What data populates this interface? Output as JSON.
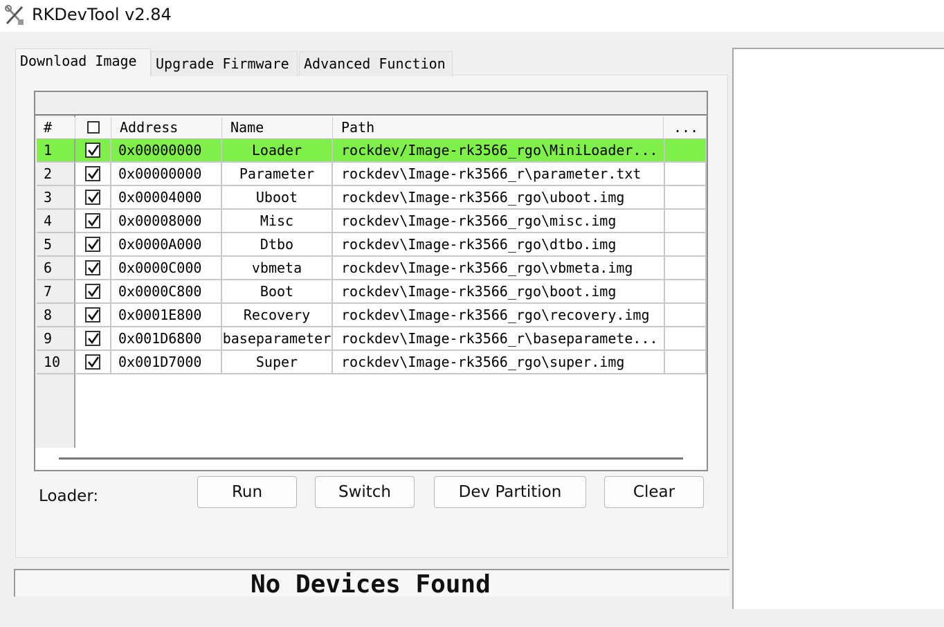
{
  "window": {
    "title": "RKDevTool v2.84",
    "icon": "rk-tools-icon"
  },
  "tabs": [
    {
      "label": "Download Image",
      "active": true
    },
    {
      "label": "Upgrade Firmware",
      "active": false
    },
    {
      "label": "Advanced Function",
      "active": false
    }
  ],
  "table": {
    "headers": {
      "num": "#",
      "address": "Address",
      "name": "Name",
      "path": "Path",
      "extra": "..."
    },
    "rows": [
      {
        "num": "1",
        "checked": true,
        "address": "0x00000000",
        "name": "Loader",
        "path": "rockdev/Image-rk3566_rgo\\MiniLoader...",
        "selected": true
      },
      {
        "num": "2",
        "checked": true,
        "address": "0x00000000",
        "name": "Parameter",
        "path": "rockdev\\Image-rk3566_r\\parameter.txt",
        "selected": false
      },
      {
        "num": "3",
        "checked": true,
        "address": "0x00004000",
        "name": "Uboot",
        "path": "rockdev\\Image-rk3566_rgo\\uboot.img",
        "selected": false
      },
      {
        "num": "4",
        "checked": true,
        "address": "0x00008000",
        "name": "Misc",
        "path": "rockdev\\Image-rk3566_rgo\\misc.img",
        "selected": false
      },
      {
        "num": "5",
        "checked": true,
        "address": "0x0000A000",
        "name": "Dtbo",
        "path": "rockdev\\Image-rk3566_rgo\\dtbo.img",
        "selected": false
      },
      {
        "num": "6",
        "checked": true,
        "address": "0x0000C000",
        "name": "vbmeta",
        "path": "rockdev\\Image-rk3566_rgo\\vbmeta.img",
        "selected": false
      },
      {
        "num": "7",
        "checked": true,
        "address": "0x0000C800",
        "name": "Boot",
        "path": "rockdev\\Image-rk3566_rgo\\boot.img",
        "selected": false
      },
      {
        "num": "8",
        "checked": true,
        "address": "0x0001E800",
        "name": "Recovery",
        "path": "rockdev\\Image-rk3566_rgo\\recovery.img",
        "selected": false
      },
      {
        "num": "9",
        "checked": true,
        "address": "0x001D6800",
        "name": "baseparameter",
        "path": "rockdev\\Image-rk3566_r\\baseparamete...",
        "selected": false
      },
      {
        "num": "10",
        "checked": true,
        "address": "0x001D7000",
        "name": "Super",
        "path": "rockdev\\Image-rk3566_rgo\\super.img",
        "selected": false
      }
    ]
  },
  "loader_label": "Loader:",
  "buttons": {
    "run": "Run",
    "switch": "Switch",
    "dev_partition": "Dev Partition",
    "clear": "Clear"
  },
  "status": "No Devices Found",
  "colors": {
    "selected_row": "#7ff04a"
  }
}
